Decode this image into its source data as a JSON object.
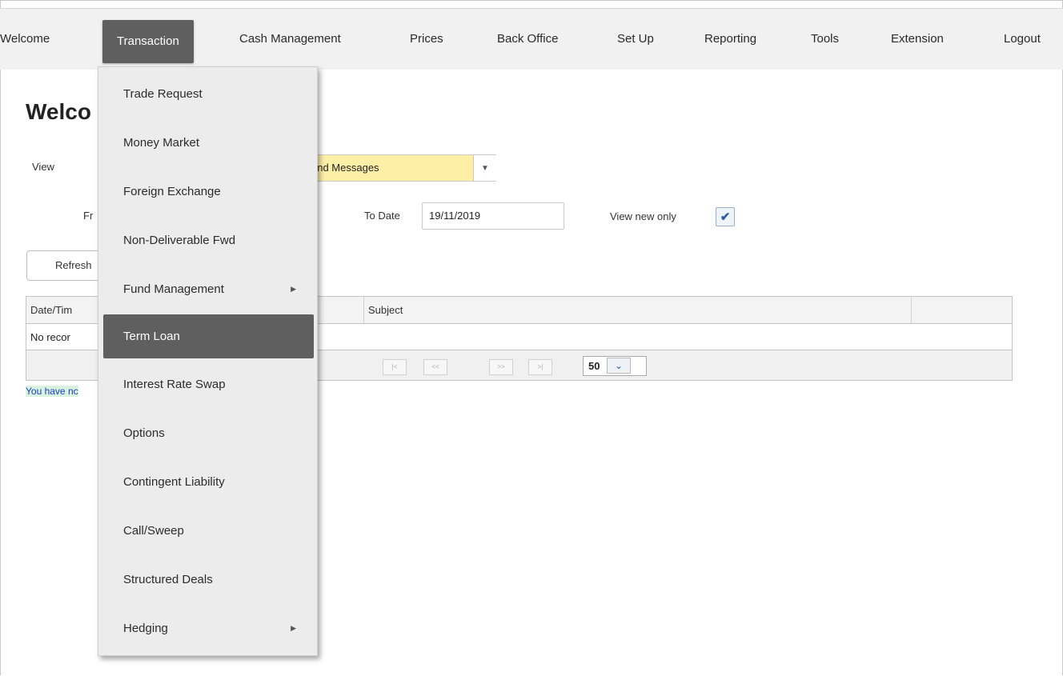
{
  "nav": {
    "items": [
      "Welcome",
      "Transaction",
      "Cash Management",
      "Prices",
      "Back Office",
      "Set Up",
      "Reporting",
      "Tools",
      "Extension",
      "Logout"
    ],
    "active": "Transaction"
  },
  "page": {
    "title": "Welco",
    "view_label": "View",
    "view_value": "and Messages",
    "from_label": "Fr",
    "to_date_label": "To Date",
    "to_date_value": "19/11/2019",
    "view_new_only_label": "View new only",
    "view_new_only_checked": true,
    "refresh_label": "Refresh",
    "info_text": "You have nc"
  },
  "grid": {
    "columns": [
      "Date/Tim",
      "Subject",
      ""
    ],
    "empty_text": "No recor",
    "page_size": "50"
  },
  "menu": {
    "items": [
      {
        "label": "Trade Request",
        "submenu": false
      },
      {
        "label": "Money Market",
        "submenu": false
      },
      {
        "label": "Foreign Exchange",
        "submenu": false
      },
      {
        "label": "Non-Deliverable Fwd",
        "submenu": false
      },
      {
        "label": "Fund Management",
        "submenu": true
      },
      {
        "label": "Term Loan",
        "submenu": false,
        "highlighted": true
      },
      {
        "label": "Interest Rate Swap",
        "submenu": false
      },
      {
        "label": "Options",
        "submenu": false
      },
      {
        "label": "Contingent Liability",
        "submenu": false
      },
      {
        "label": "Call/Sweep",
        "submenu": false
      },
      {
        "label": "Structured Deals",
        "submenu": false
      },
      {
        "label": "Hedging",
        "submenu": true
      }
    ]
  },
  "icons": {
    "dropdown_arrow": "chevron-down-icon",
    "check": "check-icon",
    "submenu": "caret-right-icon"
  },
  "colors": {
    "active_bg": "#5f5f5f",
    "select_bg": "#fdefa6",
    "info_text": "#1a3fbf"
  }
}
